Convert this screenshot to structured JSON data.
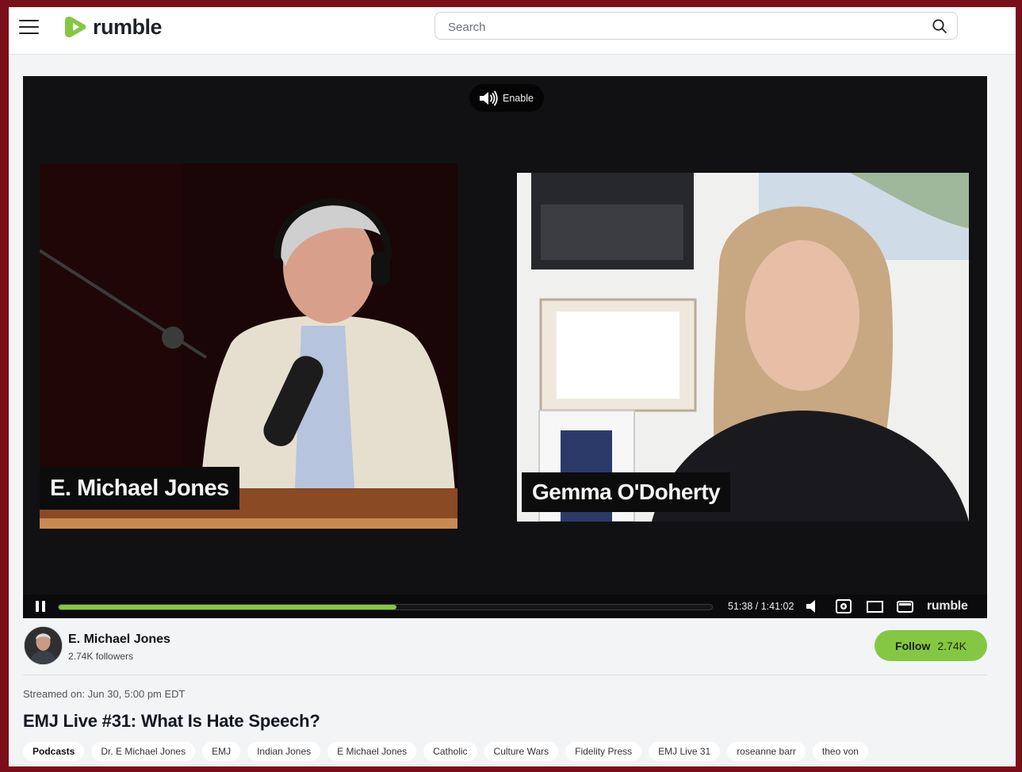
{
  "header": {
    "brand": "rumble",
    "search_placeholder": "Search",
    "brand_color": "#85c742"
  },
  "player": {
    "enable_label": "Enable",
    "left_speaker": "E. Michael Jones",
    "right_speaker": "Gemma O'Doherty",
    "time_display": "51:38 / 1:41:02",
    "progress_fraction": 0.517,
    "watermark": "rumble",
    "icons": [
      "pause-icon",
      "volume-icon",
      "settings-icon",
      "theater-mode-icon",
      "pip-icon"
    ]
  },
  "channel": {
    "name": "E. Michael Jones",
    "followers": "2.74K followers",
    "follow_label": "Follow",
    "follow_count": "2.74K"
  },
  "video": {
    "streamed_on": "Streamed on: Jun 30, 5:00 pm EDT",
    "title": "EMJ Live #31: What Is Hate Speech?"
  },
  "tags": [
    "Podcasts",
    "Dr. E Michael Jones",
    "EMJ",
    "Indian Jones",
    "E Michael Jones",
    "Catholic",
    "Culture Wars",
    "Fidelity Press",
    "EMJ Live 31",
    "roseanne barr",
    "theo von"
  ]
}
